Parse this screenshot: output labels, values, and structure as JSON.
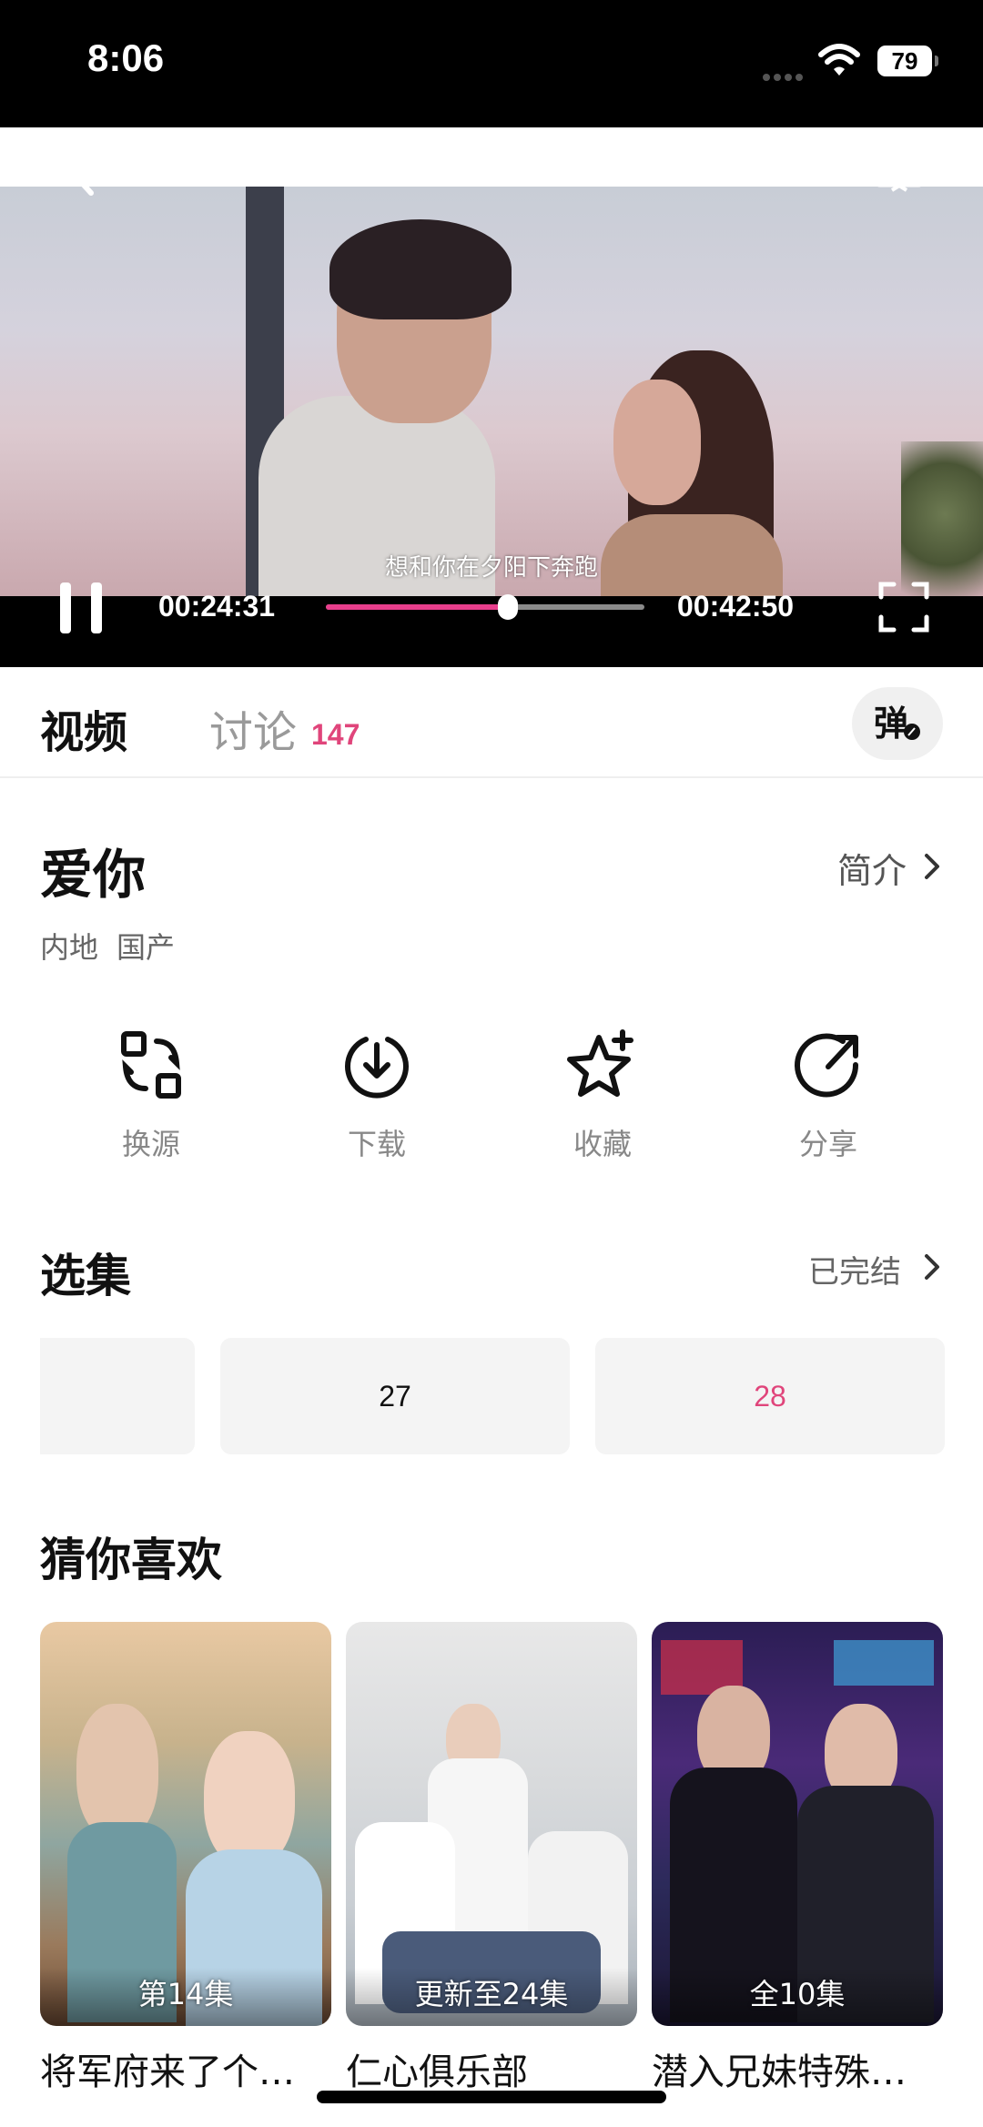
{
  "status_bar": {
    "time": "8:06",
    "battery": "79"
  },
  "player": {
    "subtitle": "想和你在夕阳下奔跑",
    "current_time": "00:24:31",
    "duration": "00:42:50",
    "progress_fraction": 0.57
  },
  "tabs": {
    "video": "视频",
    "discuss": "讨论",
    "discuss_count": "147",
    "danmu": "弹"
  },
  "show": {
    "title": "爱你",
    "intro": "简介",
    "tags": [
      "内地",
      "国产"
    ]
  },
  "actions": [
    {
      "label": "换源",
      "icon": "switch-source-icon"
    },
    {
      "label": "下载",
      "icon": "download-icon"
    },
    {
      "label": "收藏",
      "icon": "star-add-icon"
    },
    {
      "label": "分享",
      "icon": "share-icon"
    }
  ],
  "episodes": {
    "title": "选集",
    "status": "已完结",
    "items": [
      {
        "label": ""
      },
      {
        "label": "27"
      },
      {
        "label": "28",
        "active": true
      }
    ],
    "active_color": "#e0457b"
  },
  "recommend": {
    "title": "猜你喜欢",
    "items": [
      {
        "badge": "第14集",
        "name": "将军府来了个…"
      },
      {
        "badge": "更新至24集",
        "name": "仁心俱乐部"
      },
      {
        "badge": "全10集",
        "name": "潜入兄妹特殊…"
      }
    ]
  },
  "colors": {
    "accent": "#e83e8c"
  }
}
